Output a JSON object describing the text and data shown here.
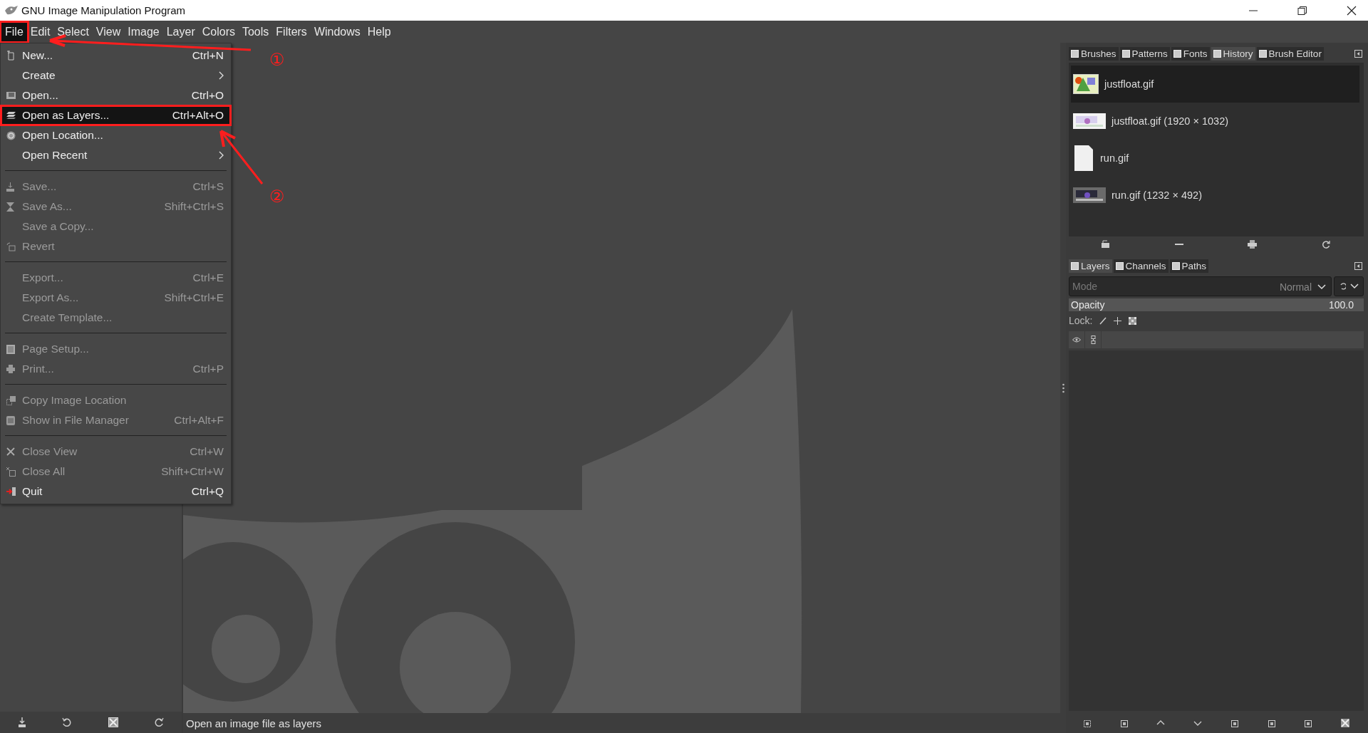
{
  "window": {
    "title": "GNU Image Manipulation Program"
  },
  "menubar": [
    {
      "label": "File",
      "selected": true,
      "annotated": true
    },
    {
      "label": "Edit",
      "selected": false,
      "annotated": false
    },
    {
      "label": "Select",
      "selected": false,
      "annotated": false
    },
    {
      "label": "View",
      "selected": false,
      "annotated": false
    },
    {
      "label": "Image",
      "selected": false,
      "annotated": false
    },
    {
      "label": "Layer",
      "selected": false,
      "annotated": false
    },
    {
      "label": "Colors",
      "selected": false,
      "annotated": false
    },
    {
      "label": "Tools",
      "selected": false,
      "annotated": false
    },
    {
      "label": "Filters",
      "selected": false,
      "annotated": false
    },
    {
      "label": "Windows",
      "selected": false,
      "annotated": false
    },
    {
      "label": "Help",
      "selected": false,
      "annotated": false
    }
  ],
  "file_menu": [
    [
      {
        "label": "New...",
        "shortcut": "Ctrl+N",
        "submenu": false,
        "disabled": false,
        "selected": false,
        "annotated": false
      },
      {
        "label": "Create",
        "submenu": true,
        "disabled": false,
        "selected": false,
        "annotated": false
      },
      {
        "label": "Open...",
        "shortcut": "Ctrl+O",
        "submenu": false,
        "disabled": false,
        "selected": false,
        "annotated": false
      },
      {
        "label": "Open as Layers...",
        "shortcut": "Ctrl+Alt+O",
        "submenu": false,
        "disabled": false,
        "selected": true,
        "annotated": true
      },
      {
        "label": "Open Location...",
        "submenu": false,
        "disabled": false,
        "selected": false,
        "annotated": false
      },
      {
        "label": "Open Recent",
        "submenu": true,
        "disabled": false,
        "selected": false,
        "annotated": false
      }
    ],
    [
      {
        "label": "Save...",
        "shortcut": "Ctrl+S",
        "submenu": false,
        "disabled": true,
        "selected": false,
        "annotated": false
      },
      {
        "label": "Save As...",
        "shortcut": "Shift+Ctrl+S",
        "submenu": false,
        "disabled": true,
        "selected": false,
        "annotated": false
      },
      {
        "label": "Save a Copy...",
        "submenu": false,
        "disabled": true,
        "selected": false,
        "annotated": false
      },
      {
        "label": "Revert",
        "submenu": false,
        "disabled": true,
        "selected": false,
        "annotated": false
      }
    ],
    [
      {
        "label": "Export...",
        "shortcut": "Ctrl+E",
        "submenu": false,
        "disabled": true,
        "selected": false,
        "annotated": false
      },
      {
        "label": "Export As...",
        "shortcut": "Shift+Ctrl+E",
        "submenu": false,
        "disabled": true,
        "selected": false,
        "annotated": false
      },
      {
        "label": "Create Template...",
        "submenu": false,
        "disabled": true,
        "selected": false,
        "annotated": false
      }
    ],
    [
      {
        "label": "Page Setup...",
        "submenu": false,
        "disabled": true,
        "selected": false,
        "annotated": false
      },
      {
        "label": "Print...",
        "shortcut": "Ctrl+P",
        "submenu": false,
        "disabled": true,
        "selected": false,
        "annotated": false
      }
    ],
    [
      {
        "label": "Copy Image Location",
        "submenu": false,
        "disabled": true,
        "selected": false,
        "annotated": false
      },
      {
        "label": "Show in File Manager",
        "shortcut": "Ctrl+Alt+F",
        "submenu": false,
        "disabled": true,
        "selected": false,
        "annotated": false
      }
    ],
    [
      {
        "label": "Close View",
        "shortcut": "Ctrl+W",
        "submenu": false,
        "disabled": true,
        "selected": false,
        "annotated": false
      },
      {
        "label": "Close All",
        "shortcut": "Shift+Ctrl+W",
        "submenu": false,
        "disabled": true,
        "selected": false,
        "annotated": false
      },
      {
        "label": "Quit",
        "shortcut": "Ctrl+Q",
        "submenu": false,
        "disabled": false,
        "selected": false,
        "annotated": false
      }
    ]
  ],
  "annotations": [
    {
      "label": "①"
    },
    {
      "label": "②"
    }
  ],
  "status_bar": "Open an image file as layers",
  "top_dock": {
    "tabs": [
      {
        "label": "Brushes",
        "selected": false
      },
      {
        "label": "Patterns",
        "selected": false
      },
      {
        "label": "Fonts",
        "selected": false
      },
      {
        "label": "History",
        "selected": true
      },
      {
        "label": "Brush Editor",
        "selected": false
      }
    ],
    "history": [
      {
        "label": "justfloat.gif",
        "kind": "icon",
        "selected": true
      },
      {
        "label": "justfloat.gif (1920 × 1032)",
        "kind": "picture",
        "selected": false
      },
      {
        "label": "run.gif",
        "kind": "icon",
        "selected": false
      },
      {
        "label": "run.gif (1232 × 492)",
        "kind": "picture",
        "selected": false
      }
    ]
  },
  "bottom_dock": {
    "tabs": [
      {
        "label": "Layers",
        "selected": true
      },
      {
        "label": "Channels",
        "selected": false
      },
      {
        "label": "Paths",
        "selected": false
      }
    ],
    "mode": {
      "placeholder": "Mode",
      "value": "Normal"
    },
    "opacity": {
      "label": "Opacity",
      "reading": "100.0",
      "level": 1.0
    },
    "lock_label": "Lock:"
  }
}
